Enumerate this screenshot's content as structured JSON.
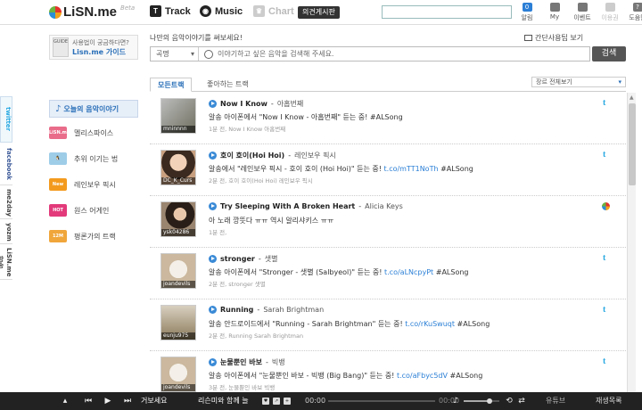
{
  "header": {
    "logo": "LiSN.me",
    "beta": "Beta",
    "nav": [
      {
        "label": "Track"
      },
      {
        "label": "Music"
      },
      {
        "label": "Chart"
      }
    ],
    "opinion_button": "의견게시판",
    "icons": [
      {
        "label": "알림",
        "badge": "0"
      },
      {
        "label": "My"
      },
      {
        "label": "이벤트"
      },
      {
        "label": "이용권"
      },
      {
        "label": "도움말"
      }
    ]
  },
  "guide": {
    "line1": "사용법이 궁금하다면?",
    "line2": "Lisn.me 가이드",
    "book": "GUIDE"
  },
  "composer": {
    "heading": "나만의 음악이야기를 써보세요!",
    "simple_view": "간단사용팁 보기",
    "select_value": "곡명",
    "placeholder": "이야기하고 싶은 음악을 검색해 주세요.",
    "search_button": "검색"
  },
  "tabs": [
    {
      "label": "모든트랙"
    },
    {
      "label": "좋아하는 트랙"
    }
  ],
  "sort": {
    "value": "장르 전체보기"
  },
  "vertical_tabs": [
    "twitter",
    "facebook",
    "me2day",
    "yozm",
    "LiSN.me 방송"
  ],
  "sidebar": {
    "today": "오늘의 음악이야기",
    "items": [
      {
        "label": "멜리스파이스",
        "logo": "LiSN.me 원미"
      },
      {
        "label": "추위 이기는 법",
        "logo": "🐧"
      },
      {
        "label": "레인보우 픽시",
        "logo": "New"
      },
      {
        "label": "원스 어게인",
        "logo": "HOT"
      },
      {
        "label": "평론가의 트랙",
        "logo": "12M"
      }
    ]
  },
  "feed": [
    {
      "user": "mninnnn",
      "song": "Now I Know",
      "artist": "아홉번째",
      "message": "알송 아이폰에서 \"Now I Know - 아홉번째\" 듣는 중! #ALSong",
      "link": "",
      "meta": "1분 전,  Now I Know 아홉번째",
      "source": "twitter",
      "color": "#8a8a7a"
    },
    {
      "user": "DC_K_Curs",
      "song": "호이 호이(Hoi Hoi)",
      "artist": "레인보우 픽시",
      "message": "알송에서 \"레인보우 픽시 - 호이 호이 (Hoi Hoi)\" 듣는 중!",
      "link": "t.co/mTT1NoTh",
      "tag": "#ALSong",
      "meta": "2분 전,  호이 호이(Hoi Hoi) 레인보우 픽시",
      "source": "twitter",
      "color": "#b08a6a"
    },
    {
      "user": "ysk04286",
      "song": "Try Sleeping With A Broken Heart",
      "artist": "Alicia Keys",
      "message": "아 노래 깡뜻다 ㅠㅠ 역시 알리샤키스 ㅠㅠ",
      "link": "",
      "meta": "1분 전,",
      "source": "app",
      "color": "#5a4a3a"
    },
    {
      "user": "joandevils",
      "song": "stronger",
      "artist": "샛별",
      "message": "알송 아이폰에서 \"Stronger - 샛별 (Salbyeol)\" 듣는 중!",
      "link": "t.co/aLNcpyPt",
      "tag": "#ALSong",
      "meta": "2분 전,  stronger 샛별",
      "source": "twitter",
      "color": "#c9b9a4"
    },
    {
      "user": "eunju975",
      "song": "Running",
      "artist": "Sarah Brightman",
      "message": "알송 안드로이드에서 \"Running - Sarah Brightman\" 듣는 중!",
      "link": "t.co/rKuSwuqt",
      "tag": "#ALSong",
      "meta": "2분 전,  Running Sarah Brightman",
      "source": "twitter",
      "color": "#9a8a6a"
    },
    {
      "user": "joandevils",
      "song": "눈물뿐인 바보",
      "artist": "빅뱅",
      "message": "알송 아이폰에서 \"눈물뿐인 바보 - 빅뱅 (Big Bang)\" 듣는 중!",
      "link": "t.co/aFbyc5dV",
      "tag": "#ALSong",
      "meta": "3분 전,  눈물뿐인 바보 빅뱅",
      "source": "twitter",
      "color": "#d0c3ae"
    }
  ],
  "player": {
    "now_playing": "거보세요",
    "artist_title": "리슨미와 함께 늘",
    "time": "00:00",
    "time2": "00:00",
    "youtube": "유튜브",
    "playlist": "재생목록"
  }
}
